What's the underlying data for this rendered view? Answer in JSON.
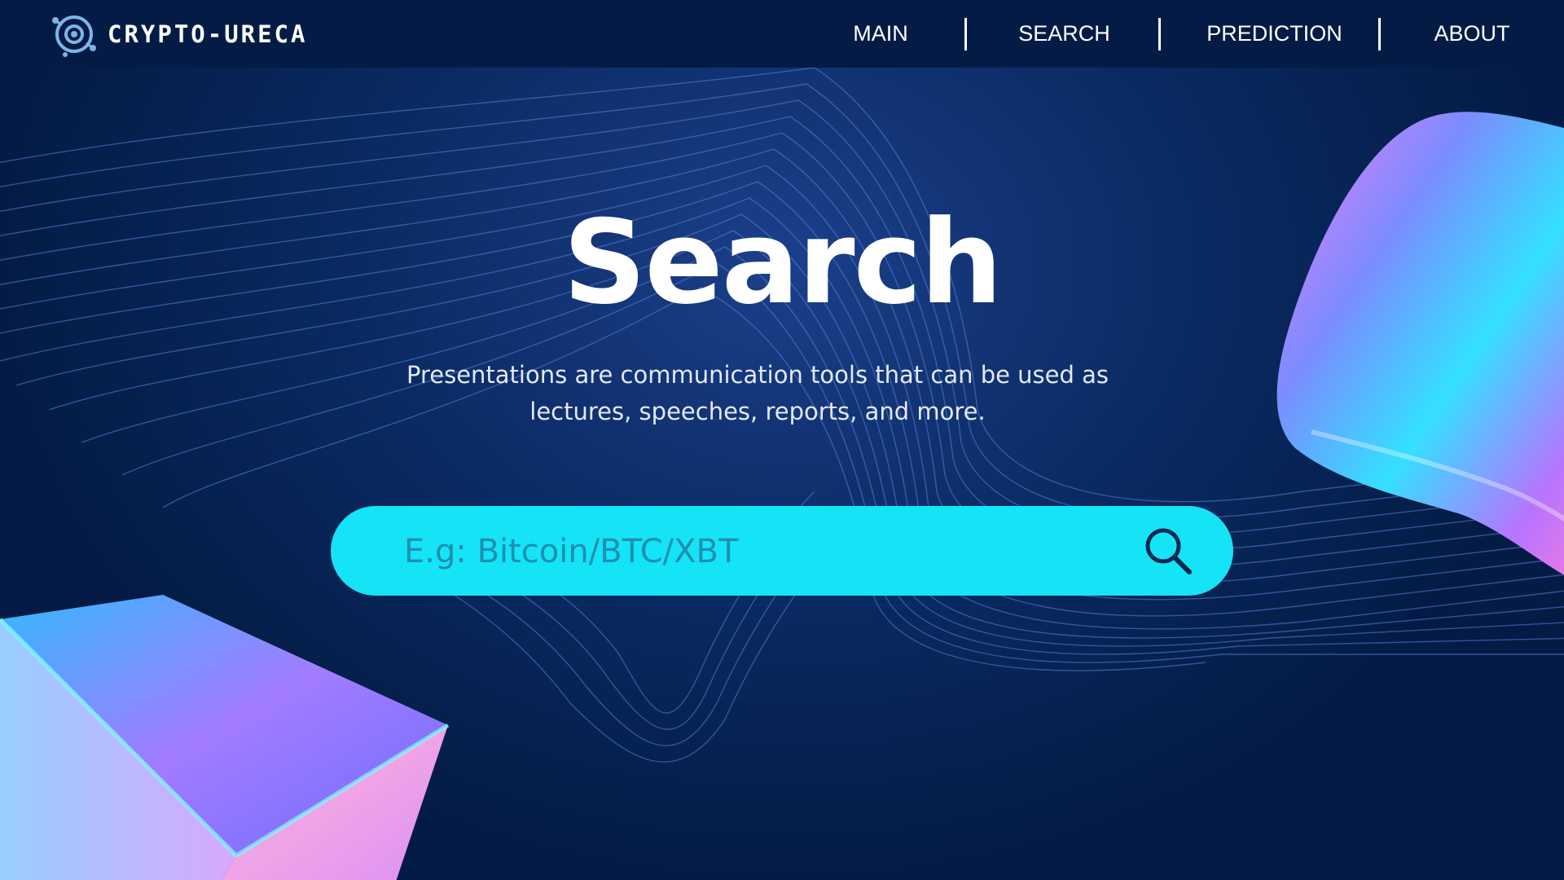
{
  "brand": {
    "name": "CRYPTO-URECA",
    "icon": "orbit-logo-icon"
  },
  "nav": {
    "items": [
      {
        "label": "MAIN"
      },
      {
        "label": "SEARCH"
      },
      {
        "label": "PREDICTION"
      },
      {
        "label": "ABOUT"
      }
    ]
  },
  "hero": {
    "title": "Search",
    "description": "Presentations are communication tools that can be used as lectures, speeches, reports, and more."
  },
  "search": {
    "placeholder": "E.g: Bitcoin/BTC/XBT",
    "value": "",
    "icon": "search-icon"
  },
  "colors": {
    "background": "#041c45",
    "accent": "#14e4f6",
    "text": "#ffffff"
  }
}
